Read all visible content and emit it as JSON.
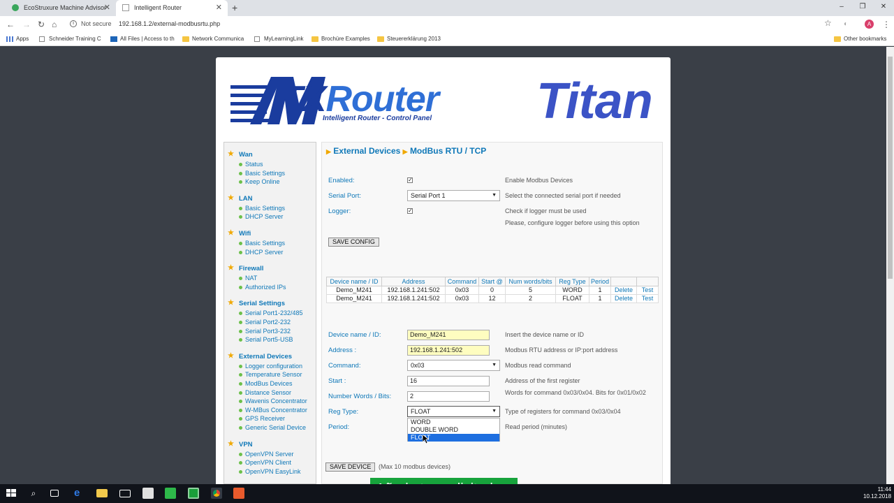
{
  "browser": {
    "tabs": [
      {
        "title": "EcoStruxure Machine Advisor",
        "active": false
      },
      {
        "title": "Intelligent Router",
        "active": true
      }
    ],
    "security_label": "Not secure",
    "url": "192.168.1.2/external-modbusrtu.php",
    "avatar_letter": "A",
    "bookmarks": [
      "Apps",
      "Schneider Training C",
      "All Files | Access to th",
      "Network Communica",
      "MyLearningLink",
      "Brochüre Examples",
      "Steuererklärung 2013"
    ],
    "other_bookmarks": "Other bookmarks"
  },
  "logo": {
    "brand_m": "M",
    "brand_tx": "TX",
    "brand_router": "Router",
    "subtitle": "Intelligent Router - Control Panel",
    "product": "Titan"
  },
  "sidebar": {
    "sections": [
      {
        "title": "Wan",
        "items": [
          "Status",
          "Basic Settings",
          "Keep Online"
        ]
      },
      {
        "title": "LAN",
        "items": [
          "Basic Settings",
          "DHCP Server"
        ]
      },
      {
        "title": "Wifi",
        "items": [
          "Basic Settings",
          "DHCP Server"
        ]
      },
      {
        "title": "Firewall",
        "items": [
          "NAT",
          "Authorized IPs"
        ]
      },
      {
        "title": "Serial Settings",
        "items": [
          "Serial Port1-232/485",
          "Serial Port2-232",
          "Serial Port3-232",
          "Serial Port5-USB"
        ]
      },
      {
        "title": "External Devices",
        "items": [
          "Logger configuration",
          "Temperature Sensor",
          "ModBus Devices",
          "Distance Sensor",
          "Wavenis Concentrator",
          "W-MBus Concentrator",
          "GPS Receiver",
          "Generic Serial Device"
        ]
      },
      {
        "title": "VPN",
        "items": [
          "OpenVPN Server",
          "OpenVPN Client",
          "OpenVPN EasyLink"
        ]
      }
    ]
  },
  "breadcrumb": {
    "first": "External Devices",
    "second": "ModBus RTU / TCP"
  },
  "config": {
    "enabled_label": "Enabled:",
    "enabled_checked": true,
    "enabled_hint": "Enable Modbus Devices",
    "serial_label": "Serial Port:",
    "serial_value": "Serial Port 1",
    "serial_hint": "Select the connected serial port if needed",
    "logger_label": "Logger:",
    "logger_checked": true,
    "logger_hint": "Check if logger must be used",
    "logger_hint2": "Please, configure logger before using this option",
    "save_config": "SAVE CONFIG"
  },
  "table": {
    "headers": [
      "Device name / ID",
      "Address",
      "Command",
      "Start @",
      "Num words/bits",
      "Reg Type",
      "Period",
      "",
      ""
    ],
    "rows": [
      [
        "Demo_M241",
        "192.168.1.241:502",
        "0x03",
        "0",
        "5",
        "WORD",
        "1",
        "Delete",
        "Test"
      ],
      [
        "Demo_M241",
        "192.168.1.241:502",
        "0x03",
        "12",
        "2",
        "FLOAT",
        "1",
        "Delete",
        "Test"
      ]
    ]
  },
  "form": {
    "name_label": "Device name / ID:",
    "name_value": "Demo_M241",
    "name_hint": "Insert the device name or ID",
    "address_label": "Address :",
    "address_value": "192.168.1.241:502",
    "address_hint": "Modbus RTU address or IP:port address",
    "command_label": "Command:",
    "command_value": "0x03",
    "command_hint": "Modbus read command",
    "start_label": "Start :",
    "start_value": "16",
    "start_hint": "Address of the first register",
    "num_label": "Number Words / Bits:",
    "num_value": "2",
    "num_hint": "Words for command 0x03/0x04. Bits for 0x01/0x02",
    "regtype_label": "Reg Type:",
    "regtype_value": "FLOAT",
    "regtype_hint": "Type of registers for command 0x03/0x04",
    "regtype_options": [
      "WORD",
      "DOUBLE WORD",
      "FLOAT"
    ],
    "period_label": "Period:",
    "period_hint": "Read period (minutes)",
    "save_device": "SAVE DEVICE",
    "max_note": "(Max 10 modbus devices)"
  },
  "caption": "Añade tus solicitudes.",
  "taskbar": {
    "time": "11:44",
    "date": "10.12.2018"
  }
}
